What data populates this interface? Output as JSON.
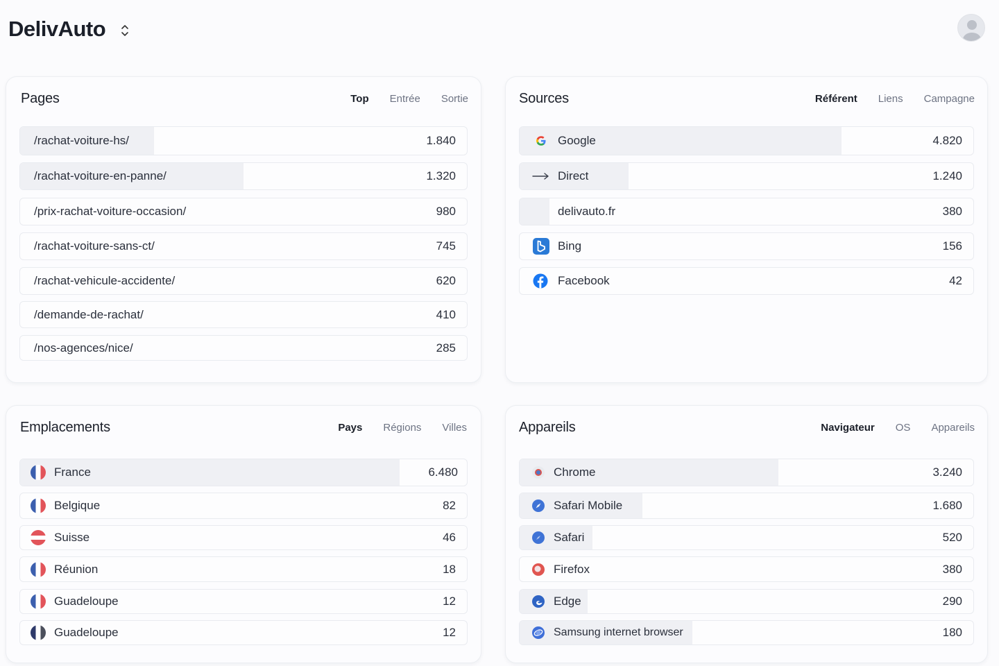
{
  "app": {
    "brand": "DelivAuto"
  },
  "pages": {
    "title": "Pages",
    "tabs": [
      {
        "label": "Top",
        "active": true
      },
      {
        "label": "Entrée",
        "active": false
      },
      {
        "label": "Sortie",
        "active": false
      }
    ],
    "rows": [
      {
        "label": "/rachat-voiture-hs/",
        "value": "1.840",
        "share": 0.3
      },
      {
        "label": "/rachat-voiture-en-panne/",
        "value": "1.320",
        "share": 0.5
      },
      {
        "label": "/prix-rachat-voiture-occasion/",
        "value": "980",
        "share": 0.0
      },
      {
        "label": "/rachat-voiture-sans-ct/",
        "value": "745",
        "share": 0.0
      },
      {
        "label": "/rachat-vehicule-accidente/",
        "value": "620",
        "share": 0.0
      },
      {
        "label": "/demande-de-rachat/",
        "value": "410",
        "share": 0.0
      },
      {
        "label": "/nos-agences/nice/",
        "value": "285",
        "share": 0.0
      }
    ]
  },
  "sources": {
    "title": "Sources",
    "tabs": [
      {
        "label": "Référent",
        "active": true
      },
      {
        "label": "Liens",
        "active": false
      },
      {
        "label": "Campagne",
        "active": false
      }
    ],
    "rows": [
      {
        "label": "Google",
        "value": "4.820",
        "share": 0.71,
        "icon": "google-icon"
      },
      {
        "label": "Direct",
        "value": "1.240",
        "share": 0.24,
        "icon": "arrow-right-icon"
      },
      {
        "label": "delivauto.fr",
        "value": "380",
        "share": 0.065,
        "icon": ""
      },
      {
        "label": "Bing",
        "value": "156",
        "share": 0.0,
        "icon": "bing-icon"
      },
      {
        "label": "Facebook",
        "value": "42",
        "share": 0.0,
        "icon": "facebook-icon"
      }
    ]
  },
  "locations": {
    "title": "Emplacements",
    "tabs": [
      {
        "label": "Pays",
        "active": true
      },
      {
        "label": "Régions",
        "active": false
      },
      {
        "label": "Villes",
        "active": false
      }
    ],
    "rows": [
      {
        "label": "France",
        "value": "6.480",
        "share": 0.85,
        "flag": "fr"
      },
      {
        "label": "Belgique",
        "value": "82",
        "share": 0.0,
        "flag": "fr"
      },
      {
        "label": "Suisse",
        "value": "46",
        "share": 0.0,
        "flag": "ch"
      },
      {
        "label": "Réunion",
        "value": "18",
        "share": 0.0,
        "flag": "fr"
      },
      {
        "label": "Guadeloupe",
        "value": "12",
        "share": 0.0,
        "flag": "fr"
      },
      {
        "label": "Guadeloupe",
        "value": "12",
        "share": 0.0,
        "flag": "fr-dark"
      }
    ]
  },
  "devices": {
    "title": "Appareils",
    "tabs": [
      {
        "label": "Navigateur",
        "active": true
      },
      {
        "label": "OS",
        "active": false
      },
      {
        "label": "Appareils",
        "active": false
      }
    ],
    "rows": [
      {
        "label": "Chrome",
        "value": "3.240",
        "share": 0.57,
        "icon": "chrome-icon"
      },
      {
        "label": "Safari Mobile",
        "value": "1.680",
        "share": 0.27,
        "icon": "safari-icon"
      },
      {
        "label": "Safari",
        "value": "520",
        "share": 0.16,
        "icon": "safari-icon"
      },
      {
        "label": "Firefox",
        "value": "380",
        "share": 0.0,
        "icon": "firefox-icon"
      },
      {
        "label": "Edge",
        "value": "290",
        "share": 0.15,
        "icon": "edge-icon"
      },
      {
        "label": "Samsung internet browser",
        "value": "180",
        "share": 0.38,
        "icon": "samsung-internet-icon"
      }
    ]
  },
  "colors": {
    "google_blue": "#4285f4",
    "google_red": "#ea4335",
    "google_yellow": "#fbbc05",
    "google_green": "#34a853",
    "bing": "#2a7ad6",
    "facebook": "#1877f2",
    "flag_blue": "#3c5fae",
    "flag_red": "#e2545a"
  }
}
